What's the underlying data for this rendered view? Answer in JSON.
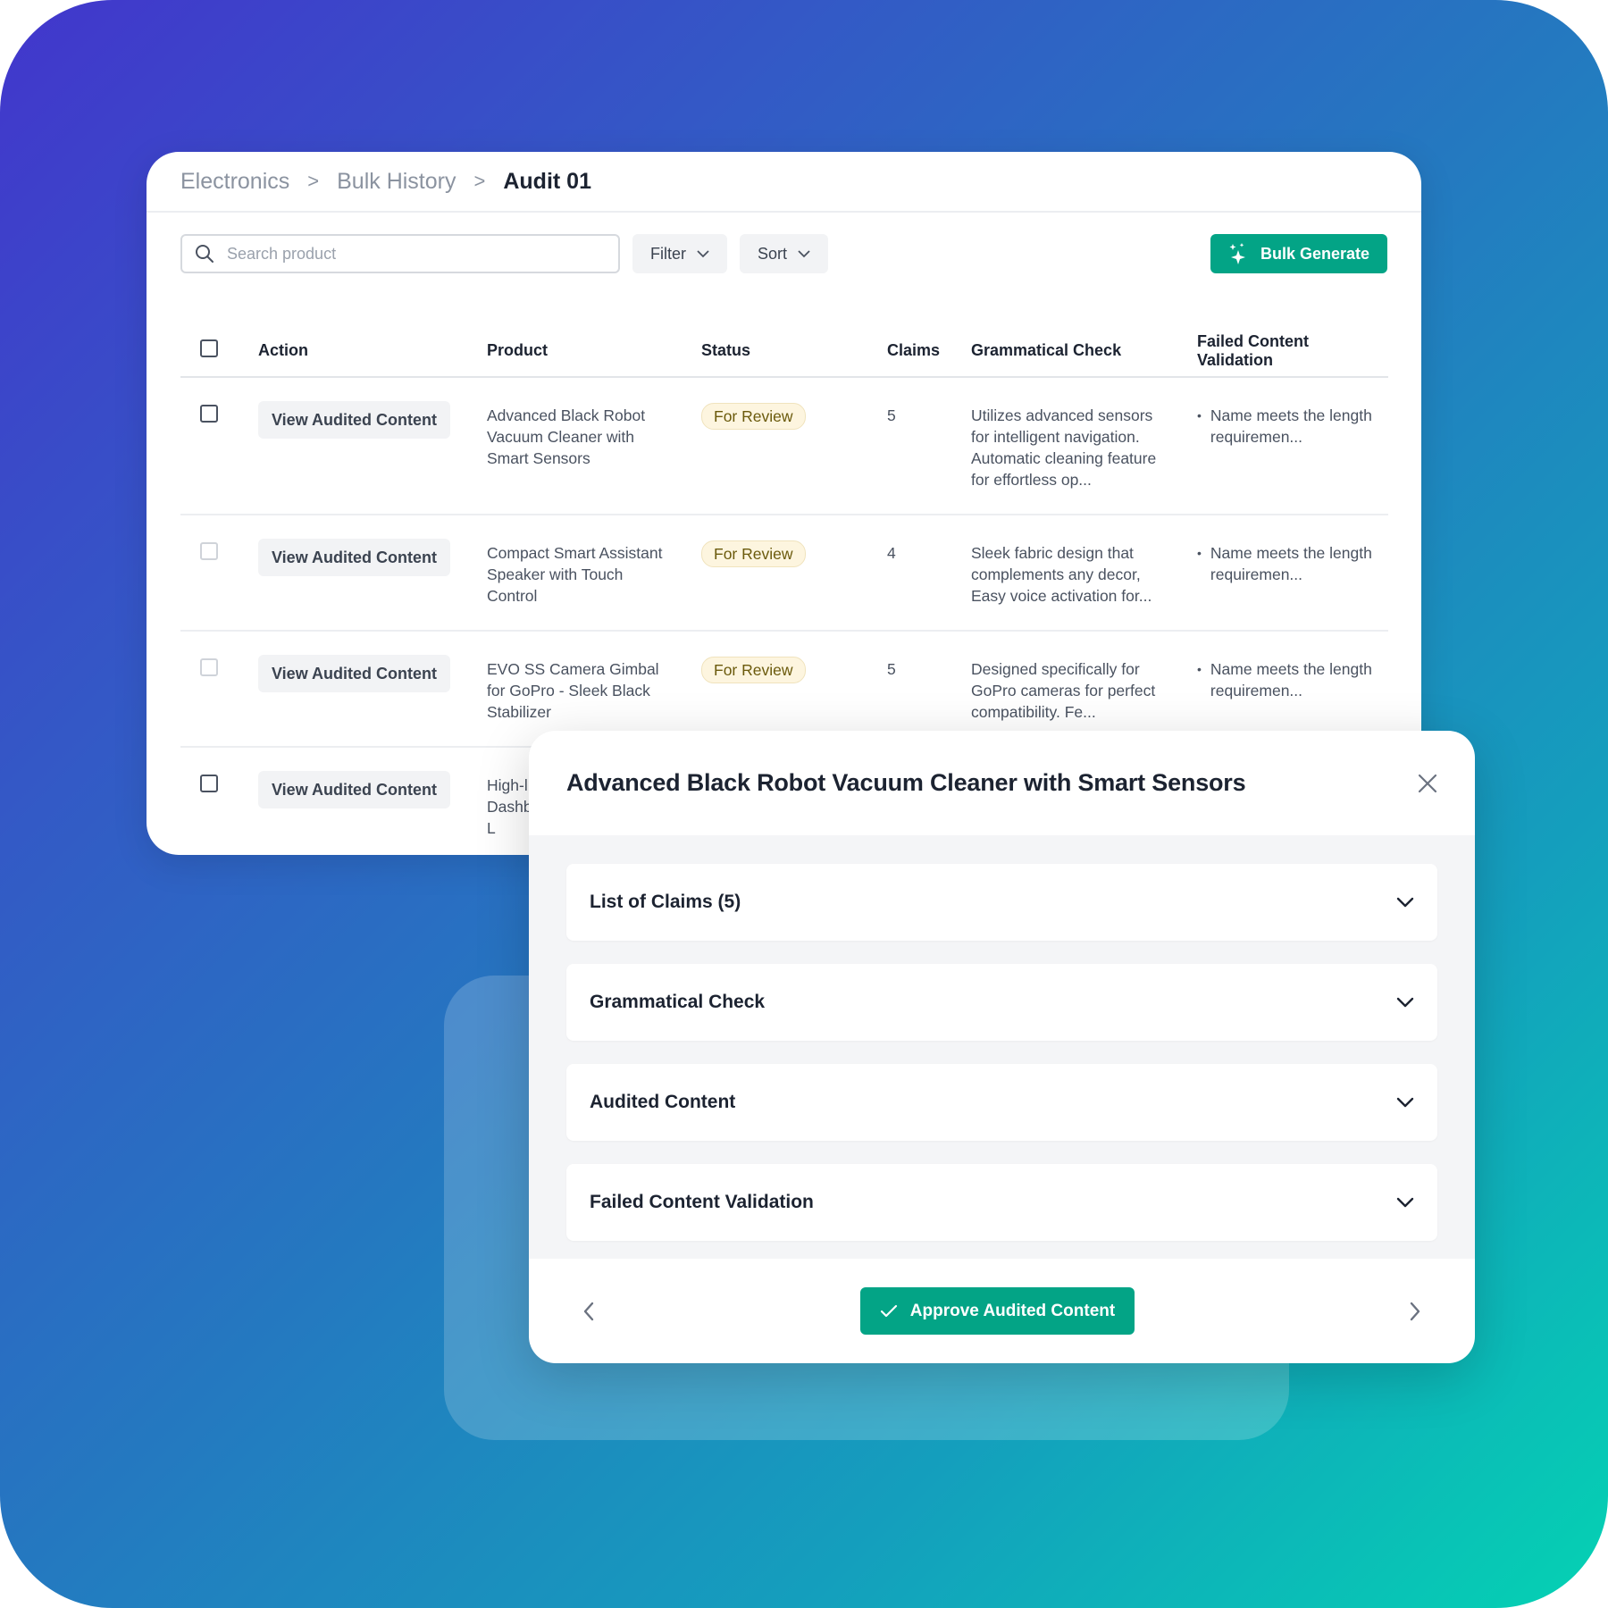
{
  "colors": {
    "accent": "#03a486",
    "badge_bg": "#fdf5df",
    "badge_text": "#6b5a0c",
    "text_primary": "#1c2331",
    "text_muted": "#8b93a0"
  },
  "breadcrumb": {
    "items": [
      "Electronics",
      "Bulk History"
    ],
    "current": "Audit 01"
  },
  "toolbar": {
    "search_placeholder": "Search product",
    "search_value": "",
    "filter_label": "Filter",
    "sort_label": "Sort",
    "bulk_generate_label": "Bulk Generate"
  },
  "table": {
    "headers": {
      "action": "Action",
      "product": "Product",
      "status": "Status",
      "claims": "Claims",
      "grammatical_check": "Grammatical Check",
      "failed_validation": "Failed Content Validation"
    },
    "rows": [
      {
        "action": "View Audited Content",
        "product": "Advanced Black Robot Vacuum Cleaner with Smart Sensors",
        "status": "For Review",
        "claims": "5",
        "grammatical_check": "Utilizes advanced sensors for intelligent navigation. Automatic cleaning feature for effortless op...",
        "failed_validation": "Name meets the length requiremen..."
      },
      {
        "action": "View Audited Content",
        "product": "Compact Smart Assistant Speaker with Touch Control",
        "status": "For Review",
        "claims": "4",
        "grammatical_check": "Sleek fabric design that complements any decor, Easy voice activation for...",
        "failed_validation": "Name meets the length requiremen..."
      },
      {
        "action": "View Audited Content",
        "product": "EVO SS Camera Gimbal for GoPro - Sleek Black Stabilizer",
        "status": "For Review",
        "claims": "5",
        "grammatical_check": "Designed specifically for GoPro cameras for perfect compatibility. Fe...",
        "failed_validation": "Name meets the length requiremen..."
      },
      {
        "action": "View Audited Content",
        "product": "High-l Dashb with L",
        "status": "",
        "claims": "",
        "grammatical_check": "",
        "failed_validation": ""
      }
    ]
  },
  "modal": {
    "title": "Advanced Black Robot Vacuum Cleaner with Smart Sensors",
    "sections": [
      {
        "label": "List of Claims (5)"
      },
      {
        "label": "Grammatical Check"
      },
      {
        "label": "Audited Content"
      },
      {
        "label": "Failed Content Validation"
      }
    ],
    "approve_label": "Approve Audited Content"
  }
}
